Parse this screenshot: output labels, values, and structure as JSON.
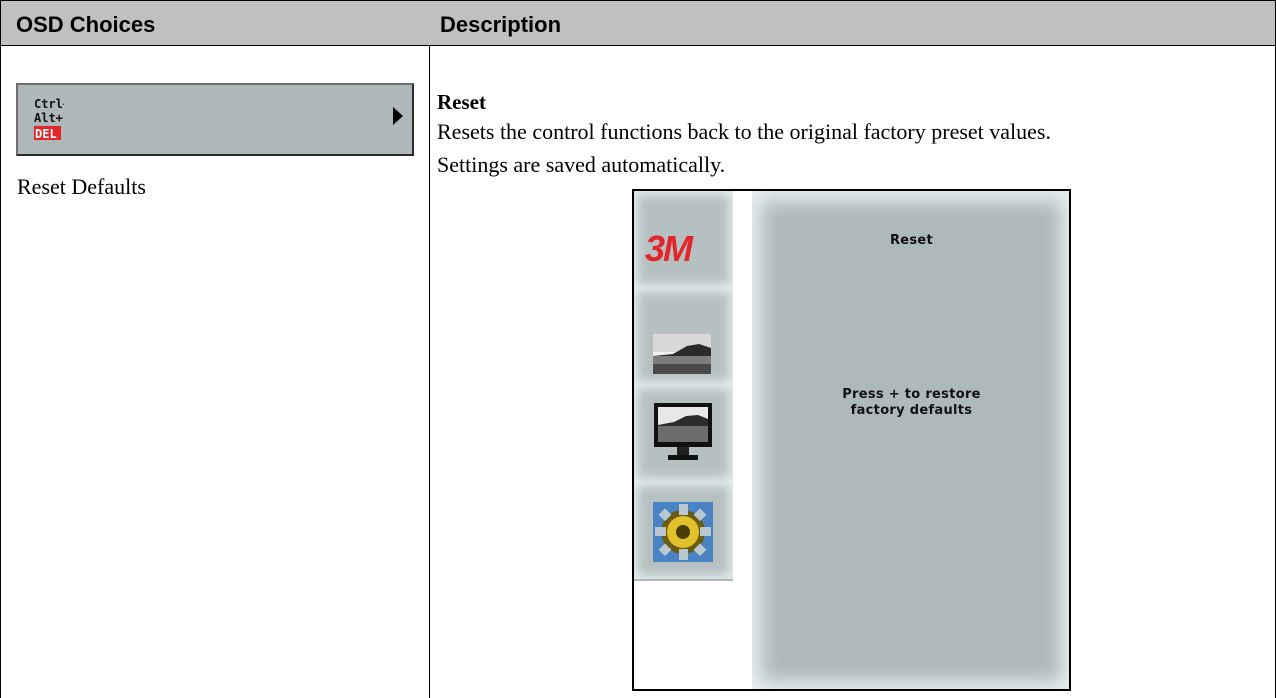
{
  "table": {
    "col1_header": "OSD Choices",
    "col2_header": "Description"
  },
  "osd_item": {
    "icon_lines": [
      "Ctrl+",
      "Alt+",
      "DEL"
    ],
    "label": "Reset Defaults"
  },
  "description": {
    "title": "Reset",
    "line1": "Resets the control functions back to the original factory preset values.",
    "line2": "Settings are saved automatically."
  },
  "osd_window": {
    "brand": "3M",
    "panel_title": "Reset",
    "message_line1": "Press + to restore",
    "message_line2": "factory defaults",
    "side_icons": [
      "3m-logo-icon",
      "picture-icon",
      "monitor-icon",
      "settings-gear-icon"
    ]
  },
  "colors": {
    "header_bg": "#c0c0c0",
    "osd_bg": "#aeb9bb",
    "brand_red": "#e3262b",
    "ctrl_red": "#e3262b"
  }
}
